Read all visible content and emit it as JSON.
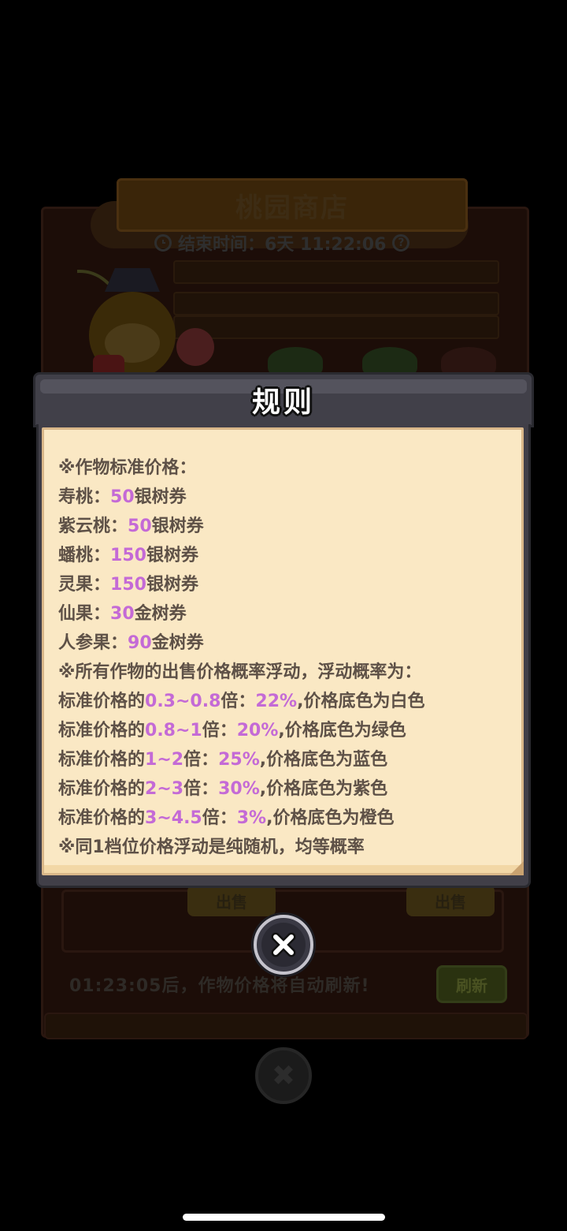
{
  "shop": {
    "title": "桃园商店",
    "timer_label": "结束时间：6天 11:22:06",
    "sell_labels": [
      "出售",
      "出售"
    ],
    "refresh_notice": "01:23:05后，作物价格将自动刷新!",
    "refresh_button": "刷新",
    "close_symbol": "✖"
  },
  "rules_modal": {
    "title": "规则",
    "lines": [
      [
        {
          "t": "※作物标准价格："
        }
      ],
      [
        {
          "t": "寿桃："
        },
        {
          "t": "50",
          "h": true
        },
        {
          "t": "银树券"
        }
      ],
      [
        {
          "t": "紫云桃："
        },
        {
          "t": "50",
          "h": true
        },
        {
          "t": "银树券"
        }
      ],
      [
        {
          "t": "蟠桃："
        },
        {
          "t": "150",
          "h": true
        },
        {
          "t": "银树券"
        }
      ],
      [
        {
          "t": "灵果："
        },
        {
          "t": "150",
          "h": true
        },
        {
          "t": "银树券"
        }
      ],
      [
        {
          "t": "仙果："
        },
        {
          "t": "30",
          "h": true
        },
        {
          "t": "金树券"
        }
      ],
      [
        {
          "t": "人参果："
        },
        {
          "t": "90",
          "h": true
        },
        {
          "t": "金树券"
        }
      ],
      [
        {
          "t": "※所有作物的出售价格概率浮动，浮动概率为："
        }
      ],
      [
        {
          "t": "标准价格的"
        },
        {
          "t": "0.3~0.8",
          "h": true
        },
        {
          "t": "倍："
        },
        {
          "t": "22%",
          "h": true
        },
        {
          "t": ",价格底色为白色"
        }
      ],
      [
        {
          "t": "标准价格的"
        },
        {
          "t": "0.8~1",
          "h": true
        },
        {
          "t": "倍："
        },
        {
          "t": "20%",
          "h": true
        },
        {
          "t": ",价格底色为绿色"
        }
      ],
      [
        {
          "t": "标准价格的"
        },
        {
          "t": "1~2",
          "h": true
        },
        {
          "t": "倍："
        },
        {
          "t": "25%",
          "h": true
        },
        {
          "t": ",价格底色为蓝色"
        }
      ],
      [
        {
          "t": "标准价格的"
        },
        {
          "t": "2~3",
          "h": true
        },
        {
          "t": "倍："
        },
        {
          "t": "30%",
          "h": true
        },
        {
          "t": ",价格底色为紫色"
        }
      ],
      [
        {
          "t": "标准价格的"
        },
        {
          "t": "3~4.5",
          "h": true
        },
        {
          "t": "倍："
        },
        {
          "t": "3%",
          "h": true
        },
        {
          "t": ",价格底色为橙色"
        }
      ],
      [
        {
          "t": "※同1档位价格浮动是纯随机，均等概率"
        }
      ]
    ],
    "close_symbol": "✖"
  },
  "colors": {
    "paper": "#fae8c4",
    "body_text": "#5e5147",
    "highlight": "#c46ad6",
    "frame": "#414049"
  },
  "icons": [
    "clock-icon",
    "help-icon",
    "close-icon"
  ]
}
